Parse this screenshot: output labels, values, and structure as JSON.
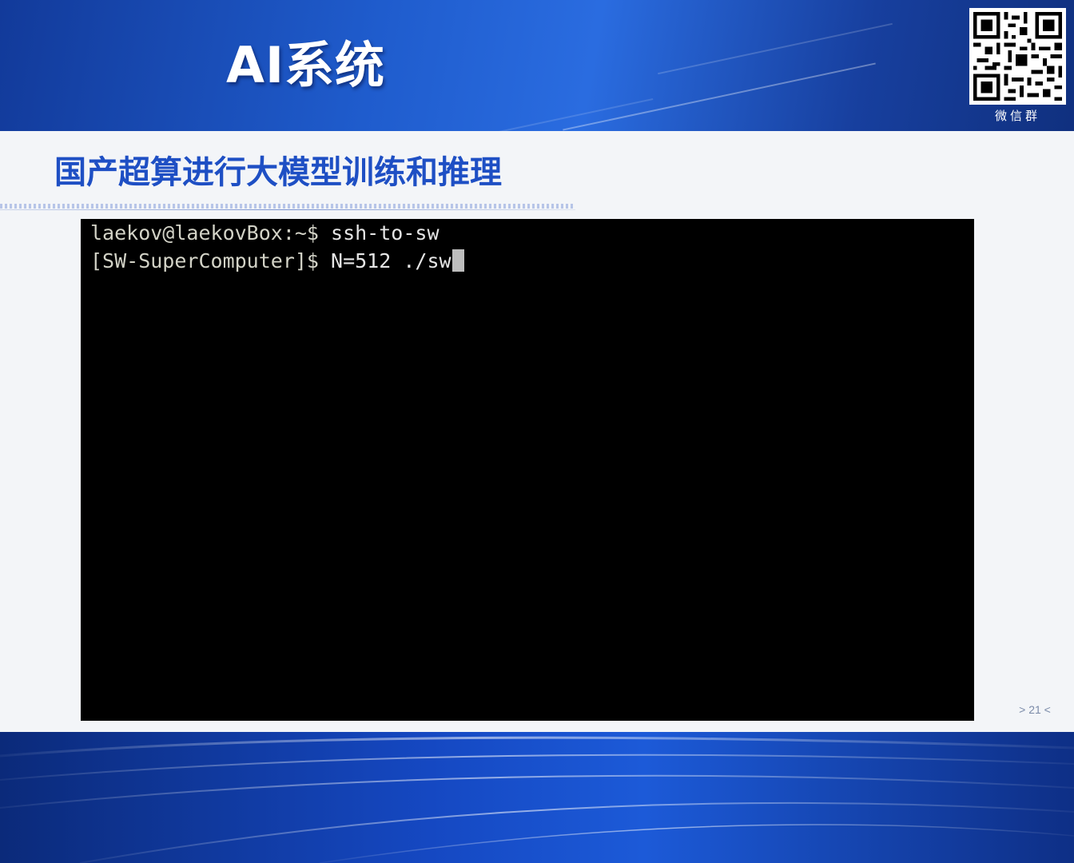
{
  "header": {
    "app_title": "AI系统",
    "qr_caption": "微信群"
  },
  "slide": {
    "title": "国产超算进行大模型训练和推理",
    "page_number": "> 21 <"
  },
  "terminal": {
    "lines": [
      {
        "prompt": "laekov@laekovBox:~$ ",
        "command": "ssh-to-sw"
      },
      {
        "prompt": "[SW-SuperComputer]$ ",
        "command": "N=512 ./sw"
      }
    ],
    "cursor": "block-cursor"
  },
  "colors": {
    "header_blue": "#1f5ccd",
    "title_blue": "#1e4fc4",
    "terminal_bg": "#000000",
    "terminal_fg": "#d9d9d9"
  }
}
